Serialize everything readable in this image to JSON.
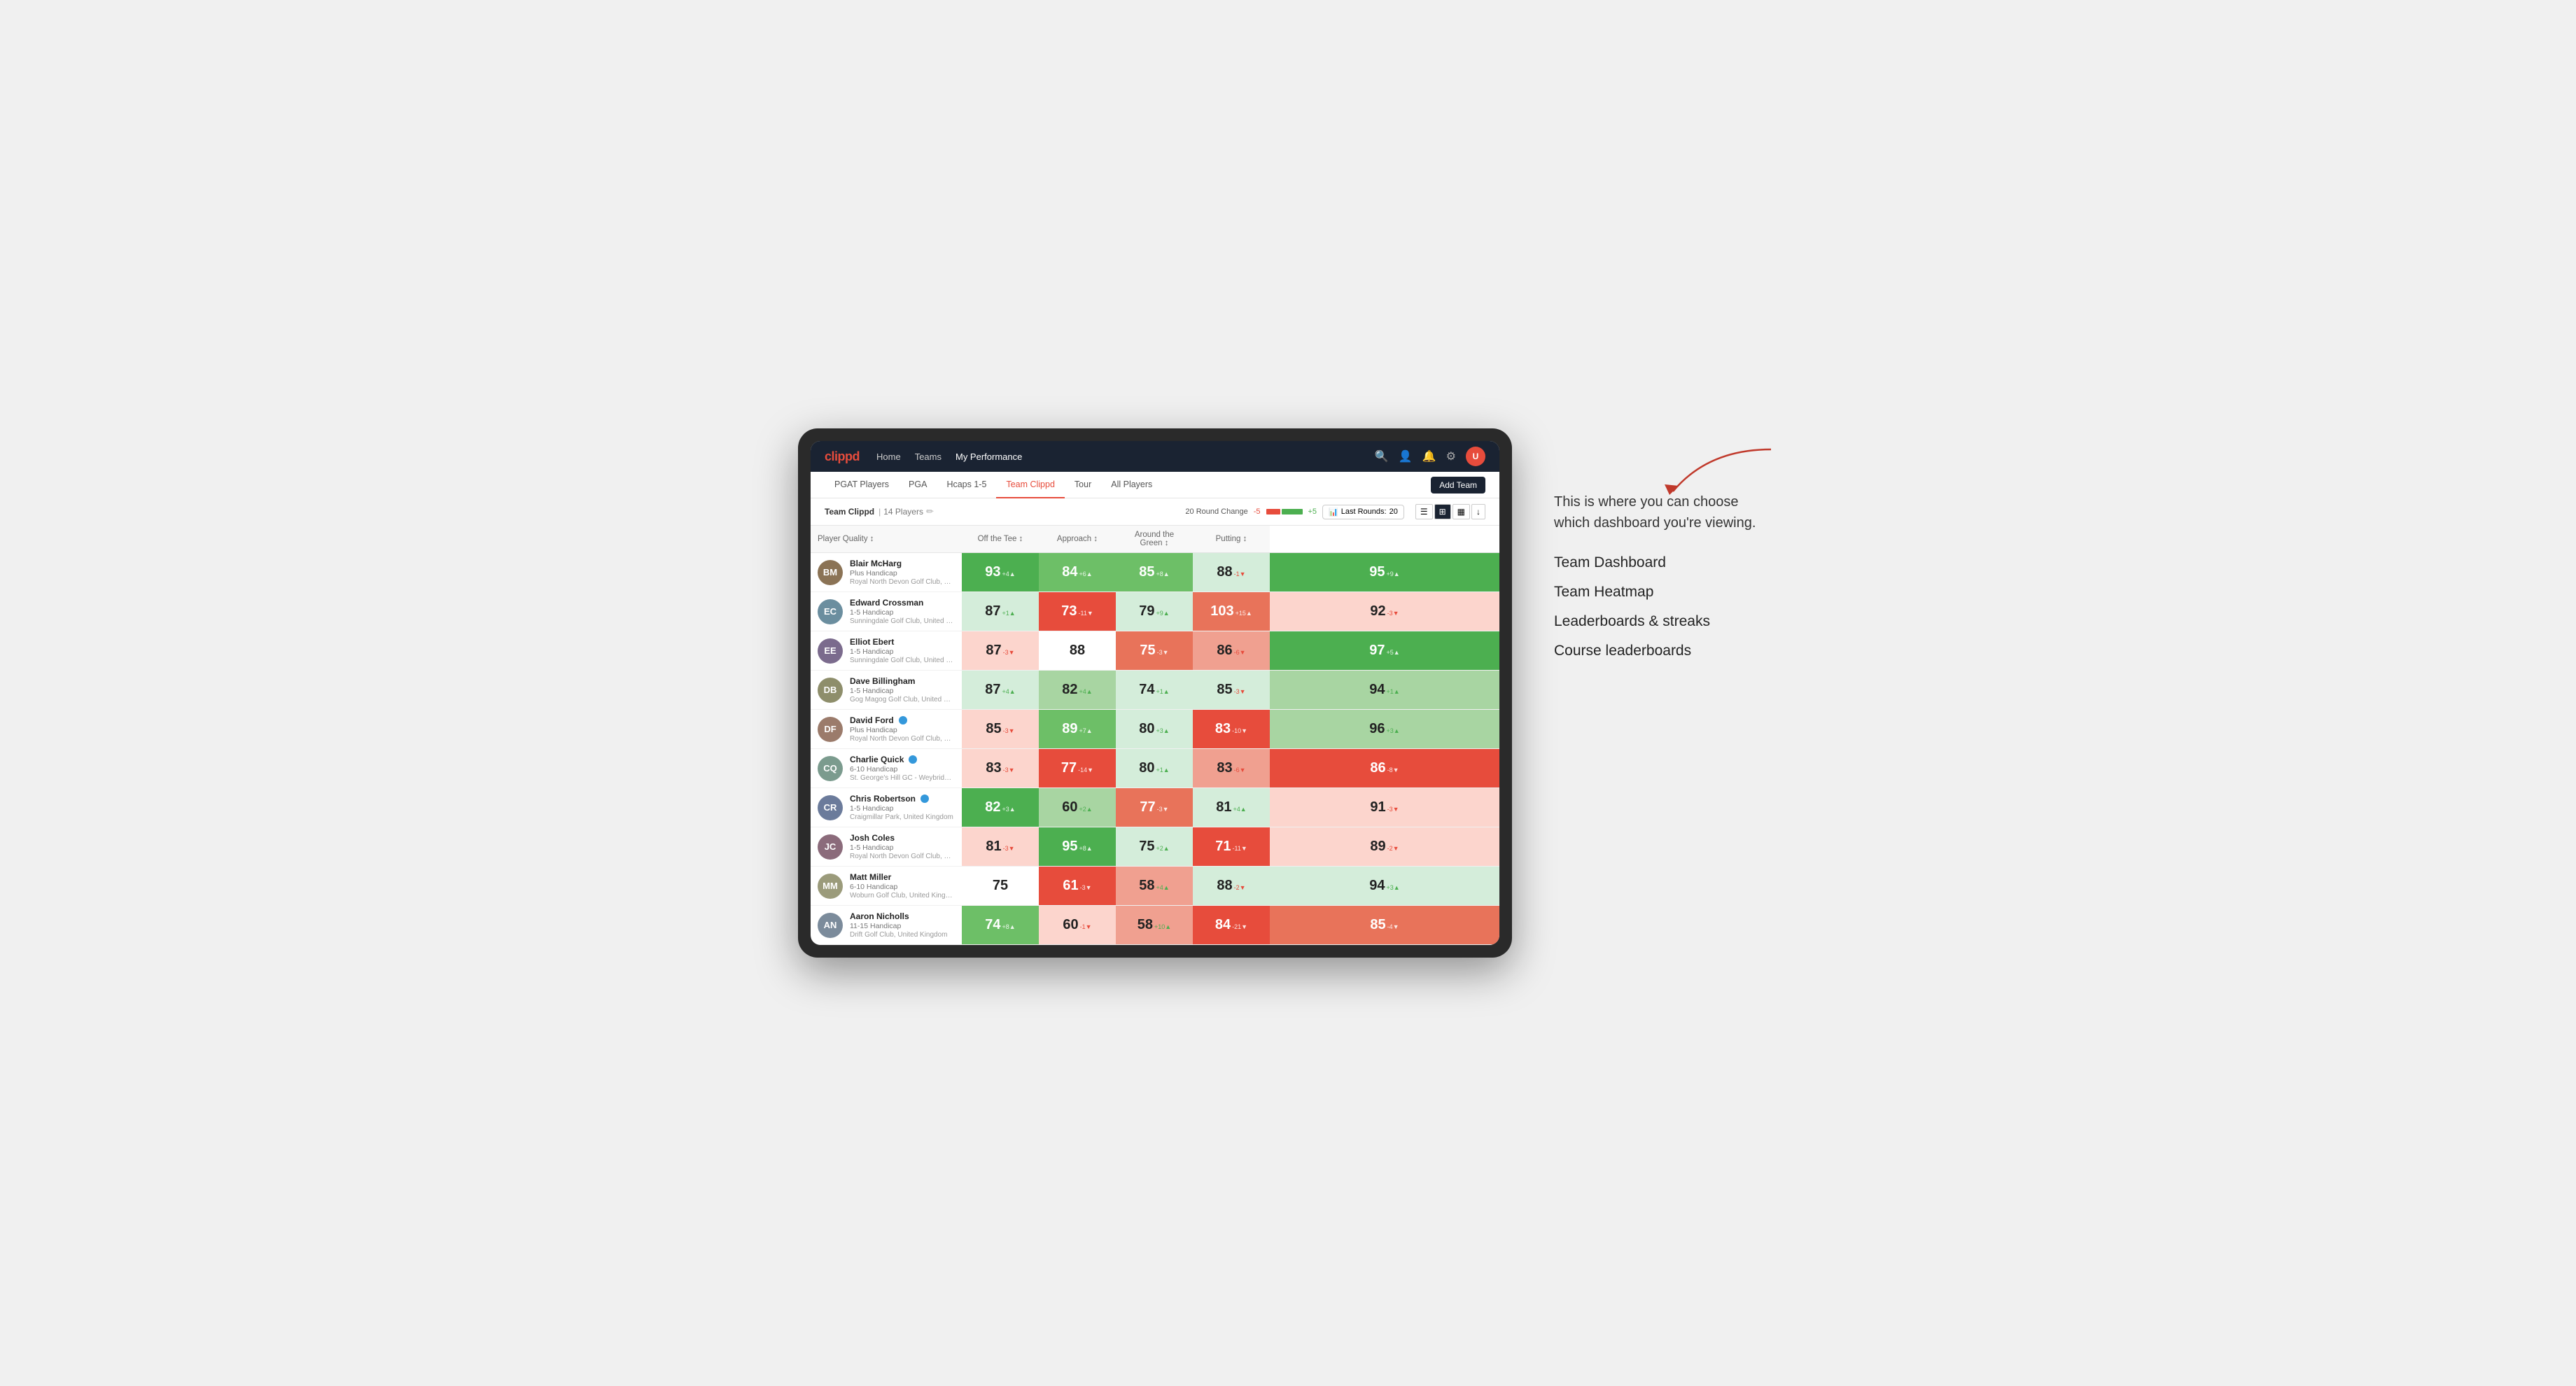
{
  "annotation": {
    "intro_text": "This is where you can choose which dashboard you're viewing.",
    "options": [
      "Team Dashboard",
      "Team Heatmap",
      "Leaderboards & streaks",
      "Course leaderboards"
    ]
  },
  "nav": {
    "logo": "clippd",
    "links": [
      "Home",
      "Teams",
      "My Performance"
    ],
    "active_link": "My Performance"
  },
  "sub_nav": {
    "links": [
      "PGAT Players",
      "PGA",
      "Hcaps 1-5",
      "Team Clippd",
      "Tour",
      "All Players"
    ],
    "active_link": "Team Clippd",
    "add_team_label": "Add Team"
  },
  "team_header": {
    "name": "Team Clippd",
    "separator": "|",
    "count": "14 Players",
    "round_change_label": "20 Round Change",
    "change_neg": "-5",
    "change_pos": "+5",
    "last_rounds_label": "Last Rounds:",
    "last_rounds_value": "20"
  },
  "table": {
    "columns": [
      "Player Quality ↕",
      "Off the Tee ↕",
      "Approach ↕",
      "Around the Green ↕",
      "Putting ↕"
    ],
    "rows": [
      {
        "name": "Blair McHarg",
        "handicap": "Plus Handicap",
        "club": "Royal North Devon Golf Club, United Kingdom",
        "avatar_color": "#8B7355",
        "metrics": [
          {
            "value": 93,
            "change": "+4",
            "dir": "up",
            "bg": "bg-green-strong"
          },
          {
            "value": 84,
            "change": "+6",
            "dir": "up",
            "bg": "bg-green-medium"
          },
          {
            "value": 85,
            "change": "+8",
            "dir": "up",
            "bg": "bg-green-medium"
          },
          {
            "value": 88,
            "change": "-1",
            "dir": "down",
            "bg": "bg-green-pale"
          },
          {
            "value": 95,
            "change": "+9",
            "dir": "up",
            "bg": "bg-green-strong"
          }
        ]
      },
      {
        "name": "Edward Crossman",
        "handicap": "1-5 Handicap",
        "club": "Sunningdale Golf Club, United Kingdom",
        "avatar_color": "#6B8E9F",
        "metrics": [
          {
            "value": 87,
            "change": "+1",
            "dir": "up",
            "bg": "bg-green-pale"
          },
          {
            "value": 73,
            "change": "-11",
            "dir": "down",
            "bg": "bg-red-strong"
          },
          {
            "value": 79,
            "change": "+9",
            "dir": "up",
            "bg": "bg-green-pale"
          },
          {
            "value": 103,
            "change": "+15",
            "dir": "up",
            "bg": "bg-red-medium"
          },
          {
            "value": 92,
            "change": "-3",
            "dir": "down",
            "bg": "bg-red-pale"
          }
        ]
      },
      {
        "name": "Elliot Ebert",
        "handicap": "1-5 Handicap",
        "club": "Sunningdale Golf Club, United Kingdom",
        "avatar_color": "#7B6B8D",
        "metrics": [
          {
            "value": 87,
            "change": "-3",
            "dir": "down",
            "bg": "bg-red-pale"
          },
          {
            "value": 88,
            "change": "",
            "dir": "",
            "bg": "bg-white"
          },
          {
            "value": 75,
            "change": "-3",
            "dir": "down",
            "bg": "bg-red-medium"
          },
          {
            "value": 86,
            "change": "-6",
            "dir": "down",
            "bg": "bg-red-light"
          },
          {
            "value": 97,
            "change": "+5",
            "dir": "up",
            "bg": "bg-green-strong"
          }
        ]
      },
      {
        "name": "Dave Billingham",
        "handicap": "1-5 Handicap",
        "club": "Gog Magog Golf Club, United Kingdom",
        "avatar_color": "#8E8E6B",
        "metrics": [
          {
            "value": 87,
            "change": "+4",
            "dir": "up",
            "bg": "bg-green-pale"
          },
          {
            "value": 82,
            "change": "+4",
            "dir": "up",
            "bg": "bg-green-light"
          },
          {
            "value": 74,
            "change": "+1",
            "dir": "up",
            "bg": "bg-green-pale"
          },
          {
            "value": 85,
            "change": "-3",
            "dir": "down",
            "bg": "bg-green-pale"
          },
          {
            "value": 94,
            "change": "+1",
            "dir": "up",
            "bg": "bg-green-light"
          }
        ]
      },
      {
        "name": "David Ford",
        "handicap": "Plus Handicap",
        "club": "Royal North Devon Golf Club, United Kingdom",
        "avatar_color": "#9B7B6B",
        "has_badge": true,
        "metrics": [
          {
            "value": 85,
            "change": "-3",
            "dir": "down",
            "bg": "bg-red-pale"
          },
          {
            "value": 89,
            "change": "+7",
            "dir": "up",
            "bg": "bg-green-medium"
          },
          {
            "value": 80,
            "change": "+3",
            "dir": "up",
            "bg": "bg-green-pale"
          },
          {
            "value": 83,
            "change": "-10",
            "dir": "down",
            "bg": "bg-red-strong"
          },
          {
            "value": 96,
            "change": "+3",
            "dir": "up",
            "bg": "bg-green-light"
          }
        ]
      },
      {
        "name": "Charlie Quick",
        "handicap": "6-10 Handicap",
        "club": "St. George's Hill GC - Weybridge - Surrey, Uni...",
        "avatar_color": "#7B9B8E",
        "has_badge": true,
        "metrics": [
          {
            "value": 83,
            "change": "-3",
            "dir": "down",
            "bg": "bg-red-pale"
          },
          {
            "value": 77,
            "change": "-14",
            "dir": "down",
            "bg": "bg-red-strong"
          },
          {
            "value": 80,
            "change": "+1",
            "dir": "up",
            "bg": "bg-green-pale"
          },
          {
            "value": 83,
            "change": "-6",
            "dir": "down",
            "bg": "bg-red-light"
          },
          {
            "value": 86,
            "change": "-8",
            "dir": "down",
            "bg": "bg-red-strong"
          }
        ]
      },
      {
        "name": "Chris Robertson",
        "handicap": "1-5 Handicap",
        "club": "Craigmillar Park, United Kingdom",
        "avatar_color": "#6B7B9B",
        "has_badge": true,
        "metrics": [
          {
            "value": 82,
            "change": "+3",
            "dir": "up",
            "bg": "bg-green-strong"
          },
          {
            "value": 60,
            "change": "+2",
            "dir": "up",
            "bg": "bg-green-light"
          },
          {
            "value": 77,
            "change": "-3",
            "dir": "down",
            "bg": "bg-red-medium"
          },
          {
            "value": 81,
            "change": "+4",
            "dir": "up",
            "bg": "bg-green-pale"
          },
          {
            "value": 91,
            "change": "-3",
            "dir": "down",
            "bg": "bg-red-pale"
          }
        ]
      },
      {
        "name": "Josh Coles",
        "handicap": "1-5 Handicap",
        "club": "Royal North Devon Golf Club, United Kingdom",
        "avatar_color": "#8B6B7B",
        "metrics": [
          {
            "value": 81,
            "change": "-3",
            "dir": "down",
            "bg": "bg-red-pale"
          },
          {
            "value": 95,
            "change": "+8",
            "dir": "up",
            "bg": "bg-green-strong"
          },
          {
            "value": 75,
            "change": "+2",
            "dir": "up",
            "bg": "bg-green-pale"
          },
          {
            "value": 71,
            "change": "-11",
            "dir": "down",
            "bg": "bg-red-strong"
          },
          {
            "value": 89,
            "change": "-2",
            "dir": "down",
            "bg": "bg-red-pale"
          }
        ]
      },
      {
        "name": "Matt Miller",
        "handicap": "6-10 Handicap",
        "club": "Woburn Golf Club, United Kingdom",
        "avatar_color": "#9B9B7B",
        "metrics": [
          {
            "value": 75,
            "change": "",
            "dir": "",
            "bg": "bg-white"
          },
          {
            "value": 61,
            "change": "-3",
            "dir": "down",
            "bg": "bg-red-strong"
          },
          {
            "value": 58,
            "change": "+4",
            "dir": "up",
            "bg": "bg-red-light"
          },
          {
            "value": 88,
            "change": "-2",
            "dir": "down",
            "bg": "bg-green-pale"
          },
          {
            "value": 94,
            "change": "+3",
            "dir": "up",
            "bg": "bg-green-pale"
          }
        ]
      },
      {
        "name": "Aaron Nicholls",
        "handicap": "11-15 Handicap",
        "club": "Drift Golf Club, United Kingdom",
        "avatar_color": "#7B8B9B",
        "metrics": [
          {
            "value": 74,
            "change": "+8",
            "dir": "up",
            "bg": "bg-green-medium"
          },
          {
            "value": 60,
            "change": "-1",
            "dir": "down",
            "bg": "bg-red-pale"
          },
          {
            "value": 58,
            "change": "+10",
            "dir": "up",
            "bg": "bg-red-light"
          },
          {
            "value": 84,
            "change": "-21",
            "dir": "down",
            "bg": "bg-red-strong"
          },
          {
            "value": 85,
            "change": "-4",
            "dir": "down",
            "bg": "bg-red-medium"
          }
        ]
      }
    ]
  }
}
